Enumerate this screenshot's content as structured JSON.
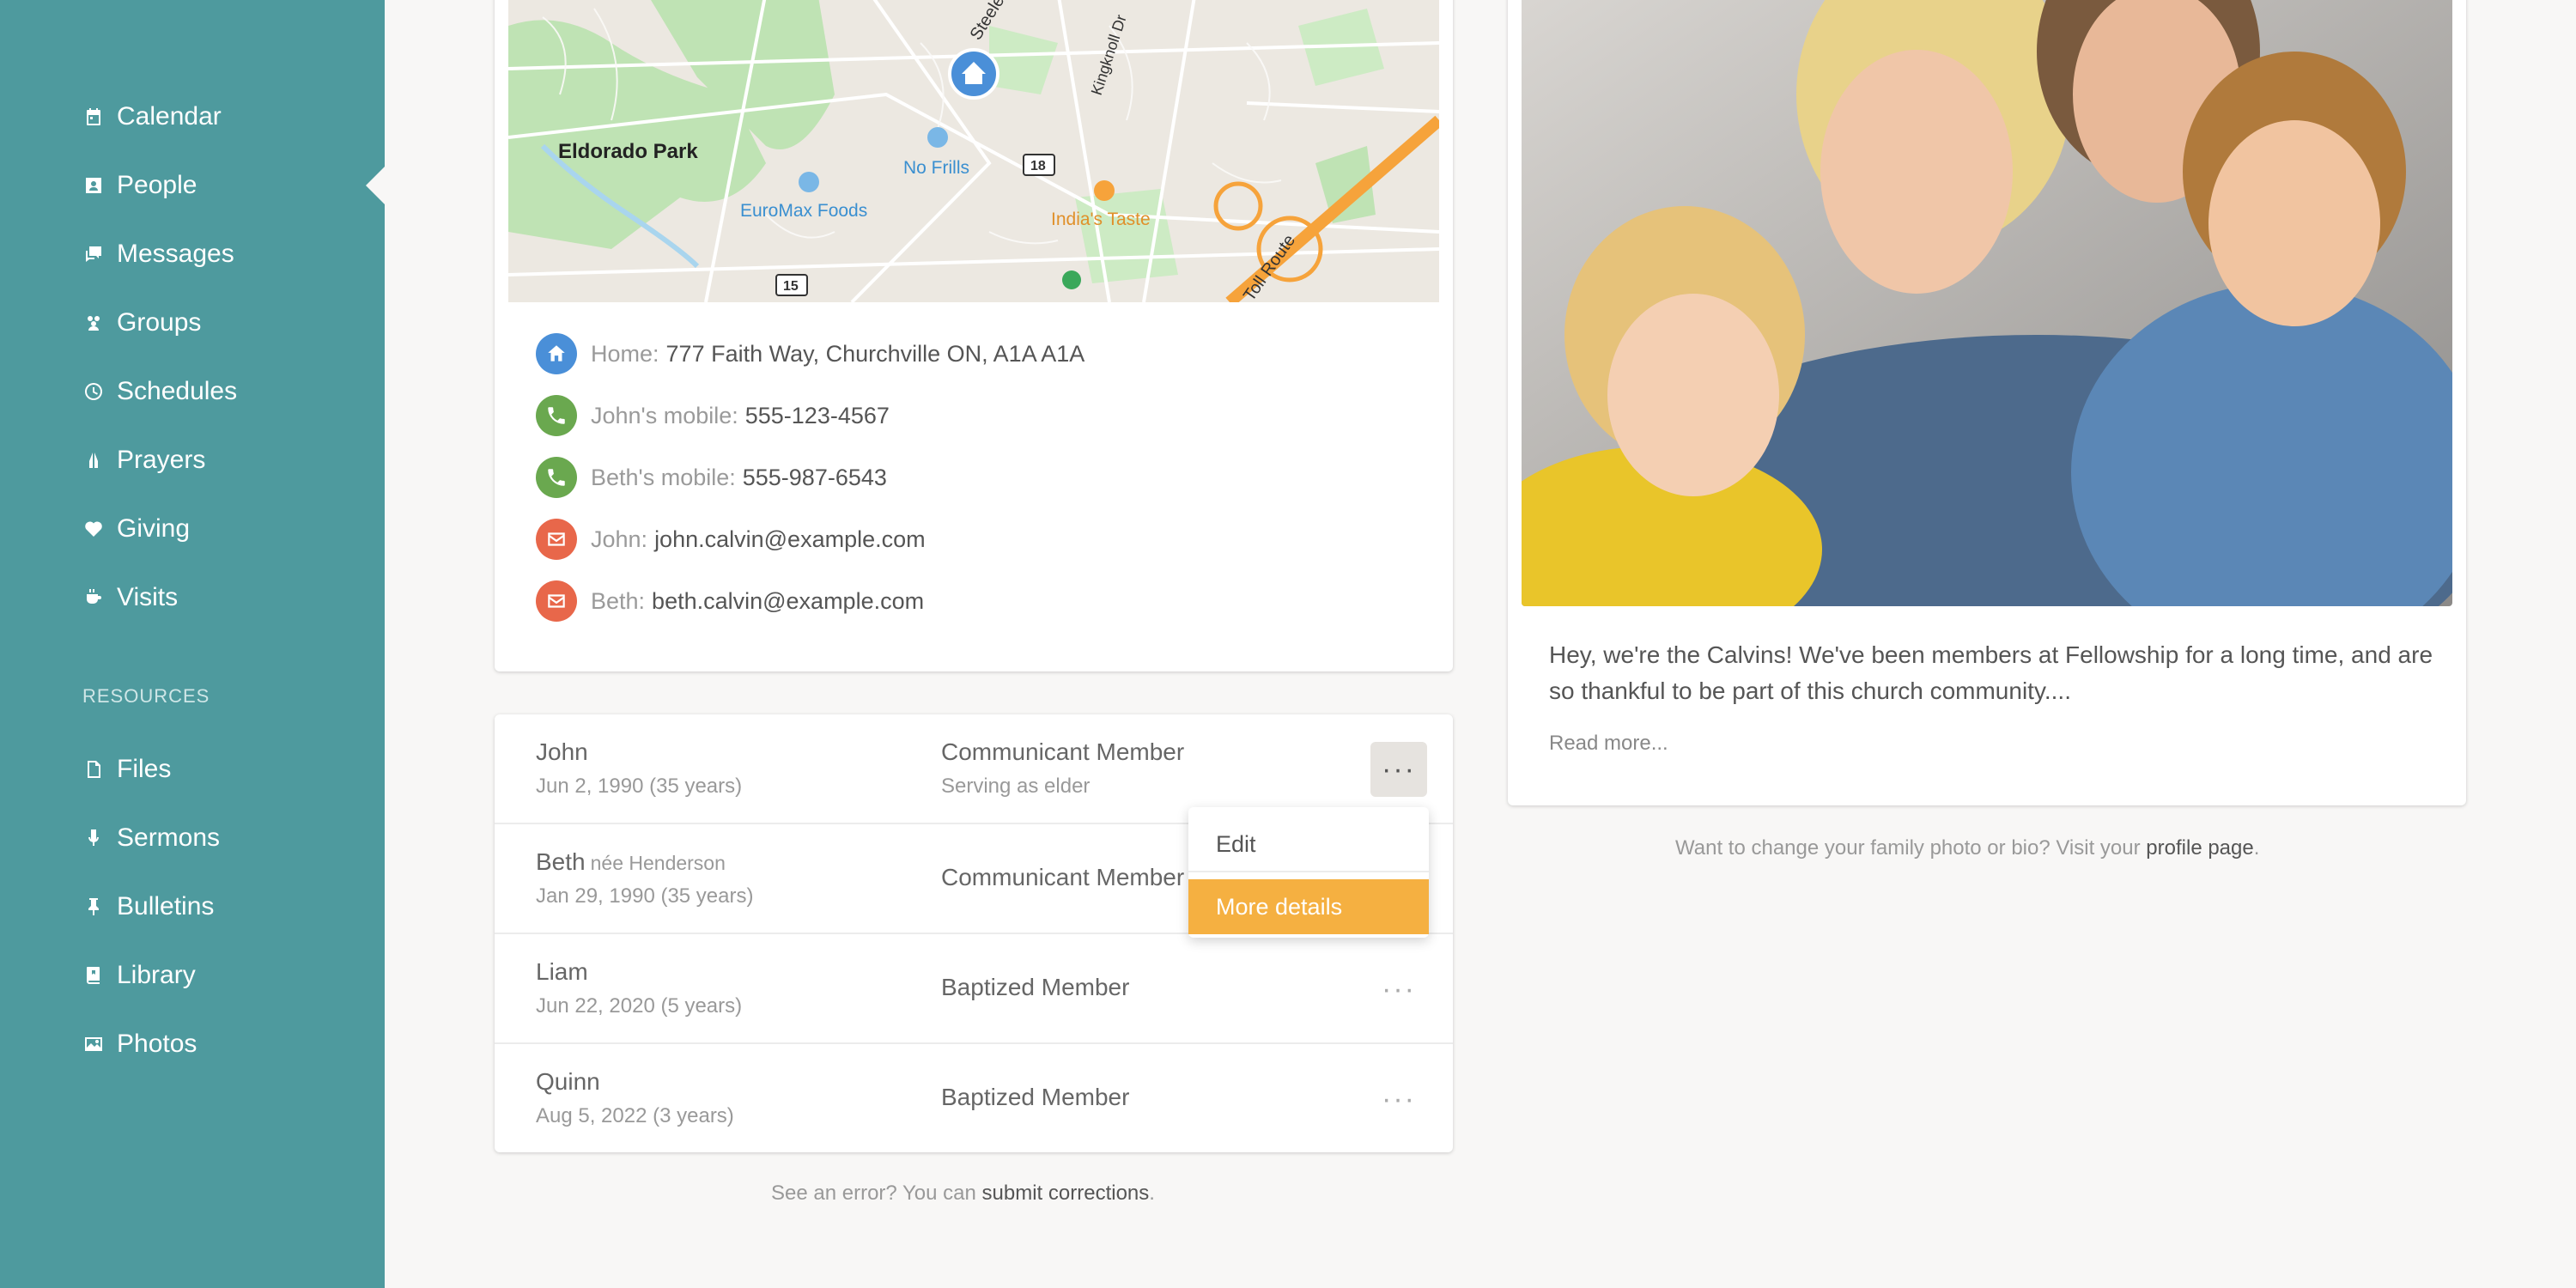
{
  "sidebar": {
    "items": [
      {
        "label": "Calendar",
        "icon": "calendar-icon"
      },
      {
        "label": "People",
        "icon": "person-icon"
      },
      {
        "label": "Messages",
        "icon": "messages-icon"
      },
      {
        "label": "Groups",
        "icon": "groups-icon"
      },
      {
        "label": "Schedules",
        "icon": "clock-icon"
      },
      {
        "label": "Prayers",
        "icon": "praying-hands-icon"
      },
      {
        "label": "Giving",
        "icon": "heart-icon"
      },
      {
        "label": "Visits",
        "icon": "coffee-cup-icon"
      }
    ],
    "resources_heading": "RESOURCES",
    "resources": [
      {
        "label": "Files",
        "icon": "file-icon"
      },
      {
        "label": "Sermons",
        "icon": "microphone-icon"
      },
      {
        "label": "Bulletins",
        "icon": "pushpin-icon"
      },
      {
        "label": "Library",
        "icon": "book-icon"
      },
      {
        "label": "Photos",
        "icon": "image-icon"
      }
    ]
  },
  "map": {
    "labels": {
      "park": "Eldorado Park",
      "store1": "No Frills",
      "store2": "EuroMax Foods",
      "restaurant": "India's Taste",
      "road1": "Steeles",
      "road2": "Kingknoll Dr",
      "road3": "Toll Route",
      "route18": "18",
      "route15": "15"
    }
  },
  "contacts": [
    {
      "label": "Home:",
      "value": "777 Faith Way, Churchville ON, A1A A1A",
      "icon": "home-icon",
      "color": "#4a8fd8"
    },
    {
      "label": "John's mobile:",
      "value": "555-123-4567",
      "icon": "phone-icon",
      "color": "#6aa84f"
    },
    {
      "label": "Beth's mobile:",
      "value": "555-987-6543",
      "icon": "phone-icon",
      "color": "#6aa84f"
    },
    {
      "label": "John:",
      "value": "john.calvin@example.com",
      "icon": "email-icon",
      "color": "#e8674a"
    },
    {
      "label": "Beth:",
      "value": "beth.calvin@example.com",
      "icon": "email-icon",
      "color": "#e8674a"
    }
  ],
  "members": [
    {
      "name": "John",
      "nee": "",
      "dob": "Jun 2, 1990 (35 years)",
      "role": "Communicant Member",
      "sub": "Serving as elder"
    },
    {
      "name": "Beth",
      "nee": "née Henderson",
      "dob": "Jan 29, 1990 (35 years)",
      "role": "Communicant Member",
      "sub": ""
    },
    {
      "name": "Liam",
      "nee": "",
      "dob": "Jun 22, 2020 (5 years)",
      "role": "Baptized Member",
      "sub": ""
    },
    {
      "name": "Quinn",
      "nee": "",
      "dob": "Aug 5, 2022 (3 years)",
      "role": "Baptized Member",
      "sub": ""
    }
  ],
  "more_button": "···",
  "dropdown": {
    "edit": "Edit",
    "more": "More details"
  },
  "footer_left": {
    "text": "See an error? You can ",
    "link": "submit corrections",
    "end": "."
  },
  "family": {
    "bio": "Hey, we're the Calvins! We've been members at Fellowship for a long time, and are so thankful to be part of this church community....",
    "read_more": "Read more...",
    "footer_text": "Want to change your family photo or bio? Visit your ",
    "footer_link": "profile page",
    "footer_end": "."
  },
  "colors": {
    "sidebar": "#4e9a9e",
    "accent": "#f5b041",
    "home": "#4a8fd8",
    "phone": "#6aa84f",
    "email": "#e8674a"
  }
}
